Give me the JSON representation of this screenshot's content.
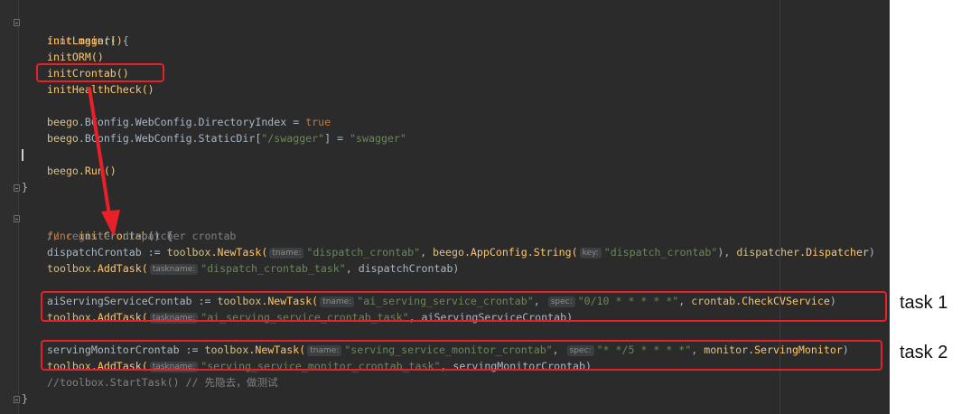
{
  "code": {
    "func_kw": "func",
    "main_name": "main",
    "open_sig": "() {",
    "main_calls": [
      "initLogger()",
      "initORM()",
      "initCrontab()",
      "initHealthCheck()"
    ],
    "beego_pkg": "beego",
    "bconfig_1": ".BConfig.WebConfig.DirectoryIndex = ",
    "true_kw": "true",
    "bconfig_2": ".BConfig.WebConfig.StaticDir[",
    "swagger_key": "\"/swagger\"",
    "assign": "] = ",
    "swagger_val": "\"swagger\"",
    "run_call": ".Run()",
    "close_brace": "}",
    "crontab_name": "initCrontab",
    "comment_register": "// register dispatcher crontab",
    "dispatch_var": "dispatchCrontab := ",
    "toolbox_pkg": "toolbox",
    "newtask": ".NewTask(",
    "addtask": ".AddTask(",
    "hint_tname": "tname:",
    "hint_key": "key:",
    "hint_taskname": "taskname:",
    "hint_spec": "spec:",
    "dispatch_tname": "\"dispatch_crontab\"",
    "sep": ", ",
    "appconfig": ".AppConfig.String(",
    "dispatch_key": "\"dispatch_crontab\"",
    "close_paren_comma": "), ",
    "dispatcher_pkg": "dispatcher",
    "dispatcher_fn": ".Dispatcher",
    "close_paren": ")",
    "dispatch_taskname": "\"dispatch_crontab_task\"",
    "dispatch_ref": ", dispatchCrontab)",
    "ai_var": "aiServingServiceCrontab := ",
    "ai_tname": "\"ai_serving_service_crontab\"",
    "ai_spec": "\"0/10 * * * * *\"",
    "crontab_pkg": "crontab",
    "ai_fn": ".CheckCVService",
    "ai_taskname": "\"ai_serving_service_crontab_task\"",
    "ai_ref": ", aiServingServiceCrontab)",
    "mon_var": "servingMonitorCrontab := ",
    "mon_tname": "\"serving_service_monitor_crontab\"",
    "mon_spec": "\"* */5 * * * *\"",
    "monitor_pkg": "monitor",
    "mon_fn": ".ServingMonitor",
    "mon_taskname": "\"serving_service_monitor_crontab_task\"",
    "mon_ref": ", servingMonitorCrontab)",
    "comment_start": "//toolbox.StartTask() // 先隐去，做测试"
  },
  "annotations": {
    "task1": "task 1",
    "task2": "task 2",
    "highlight_color": "#e8202a"
  }
}
